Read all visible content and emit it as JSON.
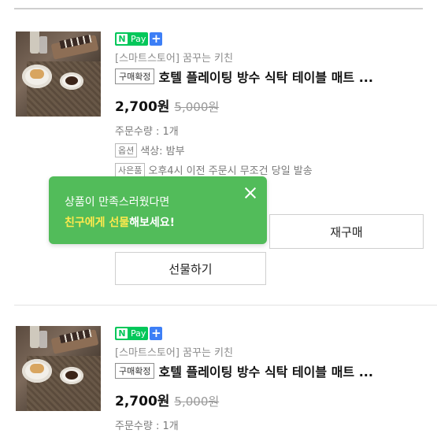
{
  "orders": [
    {
      "npay_label": "Pay",
      "npay_n": "N",
      "plus": "+",
      "store": "[스마트스토어] 꿈꾸는 키친",
      "status_badge": "구매확정",
      "product_title": "호텔 플레이팅 방수 식탁 테이블 매트 ...",
      "price": "2,700원",
      "original_price": "5,000원",
      "quantity": "주문수량 : 1개",
      "option_tag": "옵션",
      "option_value": "색상: 밤부",
      "gift_tag": "사은품",
      "gift_value": "오후4시 이전 주문시 무조건 당일 발송",
      "repurchase_label": "재구매",
      "gift_button_label": "선물하기"
    },
    {
      "npay_label": "Pay",
      "npay_n": "N",
      "plus": "+",
      "store": "[스마트스토어] 꿈꾸는 키친",
      "status_badge": "구매확정",
      "product_title": "호텔 플레이팅 방수 식탁 테이블 매트 ...",
      "price": "2,700원",
      "original_price": "5,000원",
      "quantity": "주문수량 : 1개"
    }
  ],
  "tooltip": {
    "line1": "상품이 만족스러웠다면",
    "line2_highlight": "친구에게 선물",
    "line2_rest": "해보세요!"
  },
  "colors": {
    "npay_green": "#03c75a",
    "tooltip_green": "#52bc5a",
    "plus_blue": "#3d7ff6"
  }
}
